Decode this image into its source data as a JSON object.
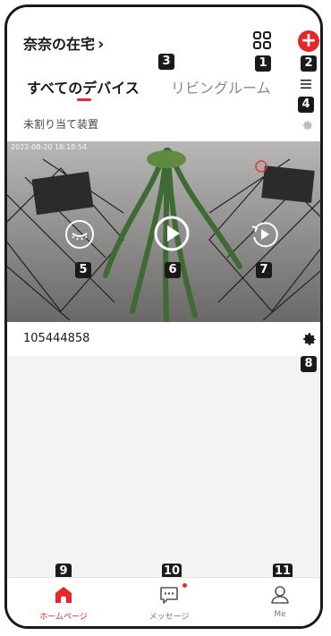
{
  "header": {
    "home_title": "奈奈の在宅",
    "home_chevron": "›",
    "add_label": "+"
  },
  "tabs": [
    {
      "label": "すべてのデバイス",
      "active": true
    },
    {
      "label": "リビングルーム",
      "active": false
    }
  ],
  "section": {
    "label": "未割り当て装置"
  },
  "camera": {
    "timestamp": "2022-08-20 18:18:54",
    "device_name": "105444858"
  },
  "badges": [
    "1",
    "2",
    "3",
    "4",
    "5",
    "6",
    "7",
    "8",
    "9",
    "10",
    "11"
  ],
  "bottom_nav": [
    {
      "label": "ホームページ",
      "icon": "home-icon",
      "active": true
    },
    {
      "label": "メッセージ",
      "icon": "message-icon",
      "active": false,
      "has_dot": true
    },
    {
      "label": "Me",
      "icon": "person-icon",
      "active": false
    }
  ],
  "colors": {
    "accent": "#e8262a",
    "text": "#1a1a1a",
    "muted": "#8a8a8a"
  }
}
